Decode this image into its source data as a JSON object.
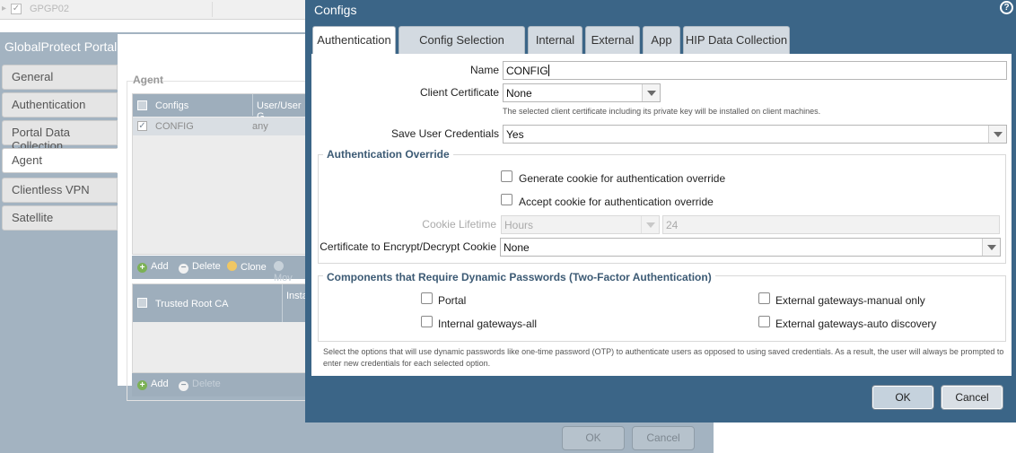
{
  "background": {
    "top_row_text": "GPGP02",
    "panel_title": "GlobalProtect Portal Configuration",
    "side_tabs": [
      "General",
      "Authentication",
      "Portal Data Collection",
      "Agent",
      "Clientless VPN",
      "Satellite"
    ],
    "active_side_tab": "Agent",
    "agent_legend": "Agent",
    "configs_table": {
      "headers": [
        "Configs",
        "User/User G"
      ],
      "rows": [
        {
          "config": "CONFIG",
          "user": "any"
        }
      ]
    },
    "configs_actions": [
      "Add",
      "Delete",
      "Clone",
      "Mov"
    ],
    "trusted_table": {
      "headers": [
        "Trusted Root CA",
        "Insta Certi"
      ]
    },
    "trusted_actions": [
      "Add",
      "Delete"
    ],
    "footer_ok": "OK",
    "footer_cancel": "Cancel"
  },
  "dialog": {
    "title": "Configs",
    "help_icon": "?",
    "tabs": [
      "Authentication",
      "Config Selection Criteria",
      "Internal",
      "External",
      "App",
      "HIP Data Collection"
    ],
    "active_tab": "Authentication",
    "name_label": "Name",
    "name_value": "CONFIG",
    "client_cert_label": "Client Certificate",
    "client_cert_value": "None",
    "client_cert_hint": "The selected client certificate including its private key will be installed on client machines.",
    "save_cred_label": "Save User Credentials",
    "save_cred_value": "Yes",
    "auth_override": {
      "legend": "Authentication Override",
      "generate_cookie": "Generate cookie for authentication override",
      "accept_cookie": "Accept cookie for authentication override",
      "cookie_lifetime_label": "Cookie Lifetime",
      "cookie_lifetime_unit": "Hours",
      "cookie_lifetime_value": "24",
      "cert_label": "Certificate to Encrypt/Decrypt Cookie",
      "cert_value": "None"
    },
    "two_factor": {
      "legend": "Components that Require Dynamic Passwords (Two-Factor Authentication)",
      "portal": "Portal",
      "internal_all": "Internal gateways-all",
      "external_manual": "External gateways-manual only",
      "external_auto": "External gateways-auto discovery"
    },
    "note": "Select the options that will use dynamic passwords like one-time password (OTP) to authenticate users as opposed to using saved credentials. As a result, the user will always be prompted to enter new credentials for each selected option.",
    "ok_label": "OK",
    "cancel_label": "Cancel"
  },
  "colors": {
    "dialog_header": "#3b6587",
    "panel_bg": "#a3b3c1",
    "legend_text": "#3c5a74"
  }
}
